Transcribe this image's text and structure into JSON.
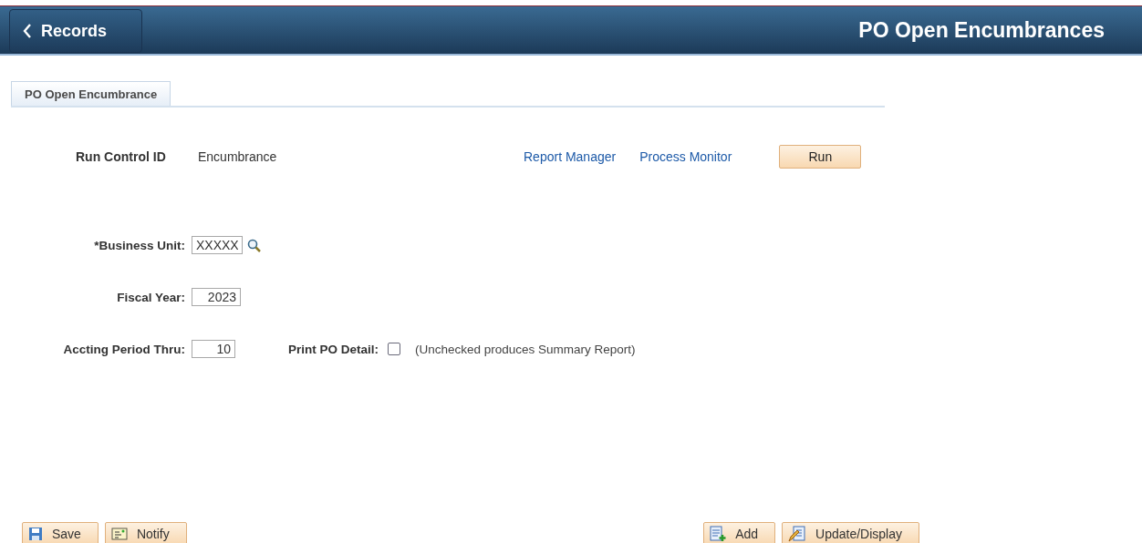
{
  "header": {
    "back_button": "Records",
    "title": "PO Open Encumbrances"
  },
  "tabs": [
    {
      "label": "PO Open Encumbrance",
      "selected": true
    }
  ],
  "run_control": {
    "label": "Run Control ID",
    "value": "Encumbrance",
    "links": [
      "Report Manager",
      "Process Monitor"
    ],
    "run_button": "Run"
  },
  "fields": [
    {
      "kind": "prompt",
      "label": "*Business Unit:",
      "value": "XXXXX"
    },
    {
      "kind": "text",
      "label": "Fiscal Year:",
      "value": "2023"
    },
    {
      "kind": "text",
      "label": "Accting Period Thru:",
      "value": "10",
      "checkbox": {
        "label": "Print PO Detail:",
        "checked": false,
        "note": "(Unchecked produces Summary Report)"
      }
    }
  ],
  "toolbar_left": [
    {
      "kind": "save",
      "label": "Save"
    },
    {
      "kind": "notify",
      "label": "Notify"
    }
  ],
  "toolbar_right": [
    {
      "kind": "add",
      "label": "Add"
    },
    {
      "kind": "update",
      "label": "Update/Display"
    }
  ]
}
